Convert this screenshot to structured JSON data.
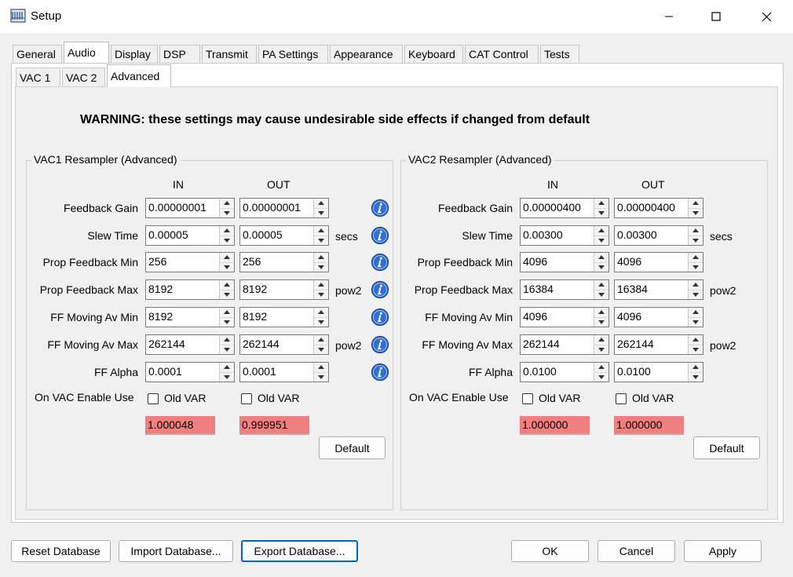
{
  "window": {
    "title": "Setup"
  },
  "main_tabs": [
    "General",
    "Audio",
    "Display",
    "DSP",
    "Transmit",
    "PA Settings",
    "Appearance",
    "Keyboard",
    "CAT Control",
    "Tests"
  ],
  "sub_tabs": [
    "VAC 1",
    "VAC 2",
    "Advanced"
  ],
  "warning": "WARNING: these settings may cause undesirable side effects if changed from default",
  "labels": {
    "in": "IN",
    "out": "OUT",
    "rows": [
      "Feedback Gain",
      "Slew Time",
      "Prop Feedback Min",
      "Prop Feedback Max",
      "FF Moving Av Min",
      "FF Moving Av Max",
      "FF Alpha"
    ],
    "on_vac_enable": "On VAC Enable Use",
    "old_var": "Old VAR",
    "default": "Default"
  },
  "vac1": {
    "title": "VAC1 Resampler (Advanced)",
    "rows": [
      {
        "in": "0.00000001",
        "out": "0.00000001",
        "unit": ""
      },
      {
        "in": "0.00005",
        "out": "0.00005",
        "unit": "secs"
      },
      {
        "in": "256",
        "out": "256",
        "unit": ""
      },
      {
        "in": "8192",
        "out": "8192",
        "unit": "pow2"
      },
      {
        "in": "8192",
        "out": "8192",
        "unit": ""
      },
      {
        "in": "262144",
        "out": "262144",
        "unit": "pow2"
      },
      {
        "in": "0.0001",
        "out": "0.0001",
        "unit": ""
      }
    ],
    "ratio_in": "1.000048",
    "ratio_out": "0.999951"
  },
  "vac2": {
    "title": "VAC2 Resampler (Advanced)",
    "rows": [
      {
        "in": "0.00000400",
        "out": "0.00000400",
        "unit": ""
      },
      {
        "in": "0.00300",
        "out": "0.00300",
        "unit": "secs"
      },
      {
        "in": "4096",
        "out": "4096",
        "unit": ""
      },
      {
        "in": "16384",
        "out": "16384",
        "unit": "pow2"
      },
      {
        "in": "4096",
        "out": "4096",
        "unit": ""
      },
      {
        "in": "262144",
        "out": "262144",
        "unit": "pow2"
      },
      {
        "in": "0.0100",
        "out": "0.0100",
        "unit": ""
      }
    ],
    "ratio_in": "1.000000",
    "ratio_out": "1.000000"
  },
  "bottom_buttons": {
    "reset": "Reset Database",
    "import": "Import Database...",
    "export": "Export Database...",
    "ok": "OK",
    "cancel": "Cancel",
    "apply": "Apply"
  },
  "colors": {
    "ratio_bg": "#f08080",
    "info_icon": "#2f6fd6",
    "focus_border": "#0067c0"
  }
}
